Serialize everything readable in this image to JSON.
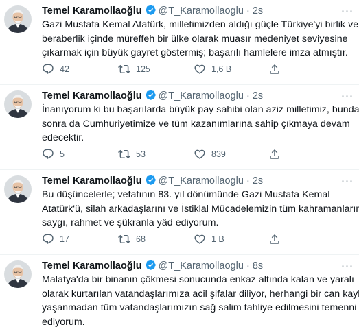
{
  "author": {
    "name": "Temel Karamollaoğlu",
    "handle": "@T_Karamollaoglu",
    "dot": "·"
  },
  "more_glyph": "···",
  "tweets": [
    {
      "time": "2s",
      "lines": [
        "Gazi Mustafa Kemal Atatürk, milletimizden aldığı güçle Türkiye'yi birlik ve",
        "beraberlik içinde müreffeh bir ülke olarak muasır medeniyet seviyesine",
        "çıkarmak için büyük gayret göstermiş; başarılı hamlelere imza atmıştır."
      ],
      "replies": "42",
      "retweets": "125",
      "likes": "1,6 B"
    },
    {
      "time": "2s",
      "lines": [
        "İnanıyorum ki bu başarılarda büyük pay sahibi olan aziz milletimiz, bundan",
        "sonra da Cumhuriyetimize ve tüm kazanımlarına sahip çıkmaya devam",
        "edecektir."
      ],
      "replies": "5",
      "retweets": "53",
      "likes": "839"
    },
    {
      "time": "2s",
      "lines": [
        "Bu düşüncelerle; vefatının 83. yıl dönümünde Gazi Mustafa Kemal",
        "Atatürk'ü, silah arkadaşlarını ve İstiklal Mücadelemizin tüm kahramanlarını",
        "saygı, rahmet ve şükranla yâd ediyorum."
      ],
      "replies": "17",
      "retweets": "68",
      "likes": "1 B"
    },
    {
      "time": "8s",
      "lines": [
        "Malatya'da bir binanın çökmesi sonucunda enkaz altında kalan ve yaralı",
        "olarak kurtarılan vatandaşlarımıza acil şifalar diliyor, herhangi bir can kaybı",
        "yaşanmadan tüm vatandaşlarımızın sağ salim tahliye edilmesini temenni",
        "ediyorum."
      ]
    }
  ],
  "colors": {
    "verified": "#1d9bf0",
    "secondary_text": "#536471",
    "divider": "#eff3f4"
  },
  "icons": [
    "verified-badge-icon",
    "reply-icon",
    "retweet-icon",
    "like-icon",
    "share-icon",
    "more-icon"
  ]
}
